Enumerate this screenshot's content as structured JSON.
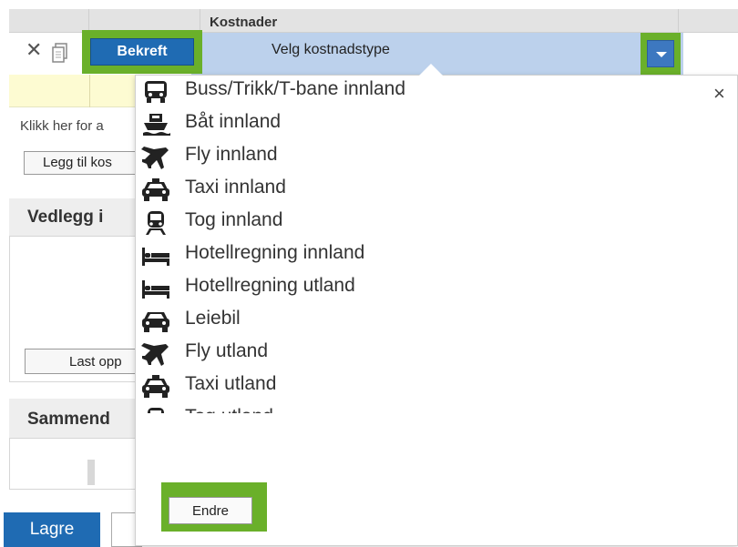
{
  "header": {
    "costs_title": "Kostnader"
  },
  "row": {
    "confirm_label": "Bekreft",
    "cost_type_placeholder": "Velg kostnadstype",
    "delete_icon": "close-icon",
    "copy_icon": "copy-icon",
    "dropdown_icon": "chevron-down-icon"
  },
  "left": {
    "hint": "Klikk her for a",
    "add_cost_label": "Legg til kos",
    "attachments_title": "Vedlegg i",
    "upload_label": "Last opp",
    "summary_title": "Sammend"
  },
  "footer": {
    "save_label": "Lagre"
  },
  "dropdown": {
    "close_glyph": "×",
    "items": [
      {
        "label": "Buss/Trikk/T-bane innland",
        "icon": "bus-icon"
      },
      {
        "label": "Båt innland",
        "icon": "boat-icon"
      },
      {
        "label": "Fly innland",
        "icon": "plane-icon"
      },
      {
        "label": "Taxi innland",
        "icon": "taxi-icon"
      },
      {
        "label": "Tog innland",
        "icon": "train-icon"
      },
      {
        "label": "Hotellregning innland",
        "icon": "bed-icon"
      },
      {
        "label": "Hotellregning utland",
        "icon": "bed-icon"
      },
      {
        "label": "Leiebil",
        "icon": "car-icon"
      },
      {
        "label": "Fly utland",
        "icon": "plane-icon"
      },
      {
        "label": "Taxi utland",
        "icon": "taxi-icon"
      },
      {
        "label": "Tog utland",
        "icon": "train-icon"
      }
    ],
    "change_label": "Endre"
  },
  "colors": {
    "highlight": "#6ab02a",
    "primary_button": "#1f6bb3",
    "selected_row": "#bcd1ec",
    "new_row": "#fdfbd2"
  }
}
